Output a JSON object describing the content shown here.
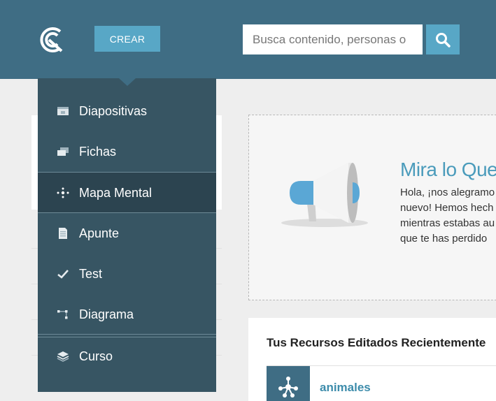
{
  "header": {
    "create_label": "CREAR",
    "search_placeholder": "Busca contenido, personas o"
  },
  "dropdown": {
    "items": [
      {
        "label": "Diapositivas",
        "icon": "slides-icon"
      },
      {
        "label": "Fichas",
        "icon": "flashcards-icon"
      },
      {
        "label": "Mapa Mental",
        "icon": "mindmap-icon"
      },
      {
        "label": "Apunte",
        "icon": "note-icon"
      },
      {
        "label": "Test",
        "icon": "check-icon"
      },
      {
        "label": "Diagrama",
        "icon": "diagram-icon"
      },
      {
        "label": "Curso",
        "icon": "course-icon"
      }
    ]
  },
  "announcement": {
    "title": "Mira lo Que",
    "line1": "Hola, ¡nos alegramo",
    "line2": "nuevo! Hemos hech",
    "line3": "mientras estabas au",
    "line4": "que te has perdido"
  },
  "recent": {
    "heading": "Tus Recursos Editados Recientemente",
    "items": [
      {
        "title": "animales",
        "icon": "mindmap-icon"
      }
    ]
  },
  "colors": {
    "topbar": "#3f6d84",
    "accent": "#58a7c6",
    "dropdown": "#375563",
    "link": "#3d8cab"
  }
}
